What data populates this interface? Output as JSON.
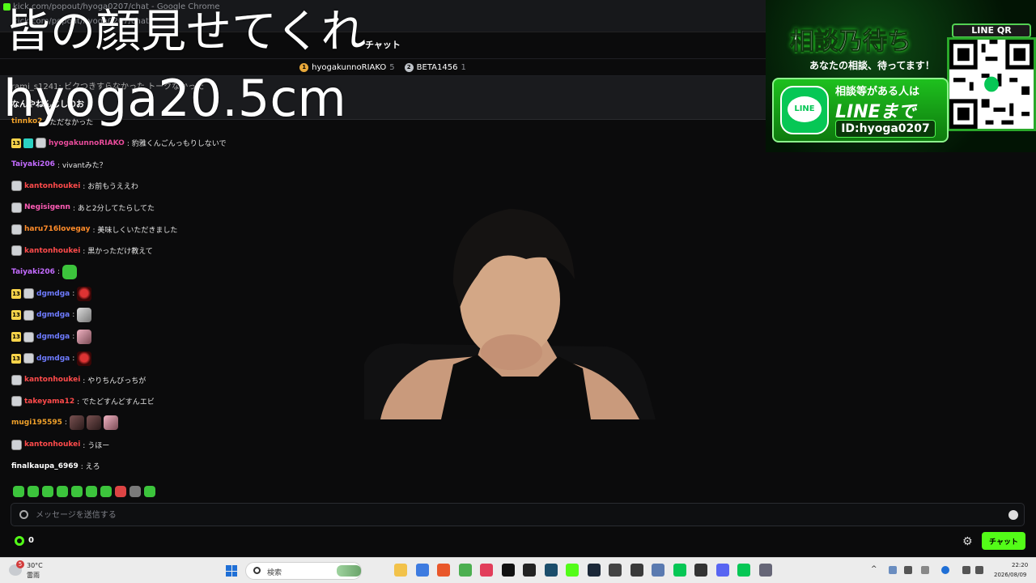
{
  "browser": {
    "tab_title": "kick.com/popout/hyoga0207/chat - Google Chrome",
    "url": "kick.com/popout/hyoga0207/chat"
  },
  "overlay": {
    "title": "皆の顔見せてくれ",
    "subtitle": "hyoga20.5cm"
  },
  "chat": {
    "title": "チャット",
    "leaderboard": [
      {
        "rank": "1",
        "name": "hyogakunnoRIAKO",
        "count": "5"
      },
      {
        "rank": "2",
        "name": "BETA1456",
        "count": "1"
      }
    ],
    "pinned": {
      "line1": "rami_s1241: ビクつきすらなかった トークなかった",
      "line2": "なんやねんじしのお"
    },
    "messages": [
      {
        "user": "tinnko2",
        "text": ": ただなかった",
        "color": "#f0a12a",
        "badges": []
      },
      {
        "user": "hyogakunnoRIAKO",
        "text": ": 豹雅くんごんっもりしないで",
        "color": "#e94b9b",
        "badges": [
          "sub",
          "gift",
          "avatar"
        ],
        "sub_label": "13"
      },
      {
        "user": "Taiyaki206",
        "text": ": vivantみた？",
        "color": "#c36bff",
        "badges": []
      },
      {
        "user": "kantonhoukei",
        "text": ": お前もうええわ",
        "color": "#ff4b4b",
        "badges": [
          "avatar"
        ]
      },
      {
        "user": "Negisigenn",
        "text": ": あと2分してたらしてた",
        "color": "#ff5cb6",
        "badges": [
          "avatar"
        ]
      },
      {
        "user": "haru716lovegay",
        "text": ": 美味しくいただきました",
        "color": "#ff8c2a",
        "badges": [
          "avatar"
        ]
      },
      {
        "user": "kantonhoukei",
        "text": ": 黒かっただけ教えて",
        "color": "#ff4b4b",
        "badges": [
          "avatar"
        ]
      },
      {
        "user": "Taiyaki206",
        "text": ":",
        "color": "#c36bff",
        "badges": [],
        "emotes": [
          "green"
        ]
      },
      {
        "user": "dgmdga",
        "text": ":",
        "color": "#6e7bff",
        "badges": [
          "sub",
          "avatar"
        ],
        "sub_label": "13",
        "emotes": [
          "red"
        ]
      },
      {
        "user": "dgmdga",
        "text": ":",
        "color": "#6e7bff",
        "badges": [
          "sub",
          "avatar"
        ],
        "sub_label": "13",
        "emotes": [
          "face"
        ]
      },
      {
        "user": "dgmdga",
        "text": ":",
        "color": "#6e7bff",
        "badges": [
          "sub",
          "avatar"
        ],
        "sub_label": "13",
        "emotes": [
          "pink"
        ]
      },
      {
        "user": "dgmdga",
        "text": ":",
        "color": "#6e7bff",
        "badges": [
          "sub",
          "avatar"
        ],
        "sub_label": "13",
        "emotes": [
          "red"
        ]
      },
      {
        "user": "kantonhoukei",
        "text": ": やりちんびっちが",
        "color": "#ff4b4b",
        "badges": [
          "avatar"
        ]
      },
      {
        "user": "takeyama12",
        "text": ": でたどすんどすんエビ",
        "color": "#ff4b4b",
        "badges": [
          "avatar"
        ]
      },
      {
        "user": "mugi195595",
        "text": ":",
        "color": "#f0a12a",
        "badges": [],
        "emotes": [
          "dark",
          "dark",
          "pink"
        ]
      },
      {
        "user": "kantonhoukei",
        "text": ": うほー",
        "color": "#ff4b4b",
        "badges": [
          "avatar"
        ]
      },
      {
        "user": "finalkaupa_6969",
        "text": ": えろ",
        "color": "#ffffff",
        "badges": []
      }
    ],
    "input_placeholder": "メッセージを送信する",
    "points": "0",
    "send_label": "チャット"
  },
  "banner": {
    "heading": "相談乃待ち",
    "sub": "あなたの相談、待ってます！",
    "qr_label": "LINE QR",
    "line_t1": "相談等がある人は",
    "line_t2": "LINEまで",
    "line_id": "ID:hyoga0207",
    "line_icon": "LINE"
  },
  "taskbar": {
    "weather_temp": "30°C",
    "weather_cond": "雷雨",
    "weather_badge": "5",
    "search_label": "検索",
    "time": "22:20",
    "date": "2026/08/09",
    "apps": [
      "file-explorer-icon",
      "store-icon",
      "brave-icon",
      "chrome-icon",
      "app-red-icon",
      "tiktok-icon",
      "app-dark-icon",
      "app-stream-icon",
      "kick-icon",
      "steam-icon",
      "app-misc-icon",
      "obs-icon",
      "app-window-icon",
      "line-icon",
      "game-icon",
      "discord-icon",
      "line2-icon",
      "settings-icon"
    ]
  }
}
